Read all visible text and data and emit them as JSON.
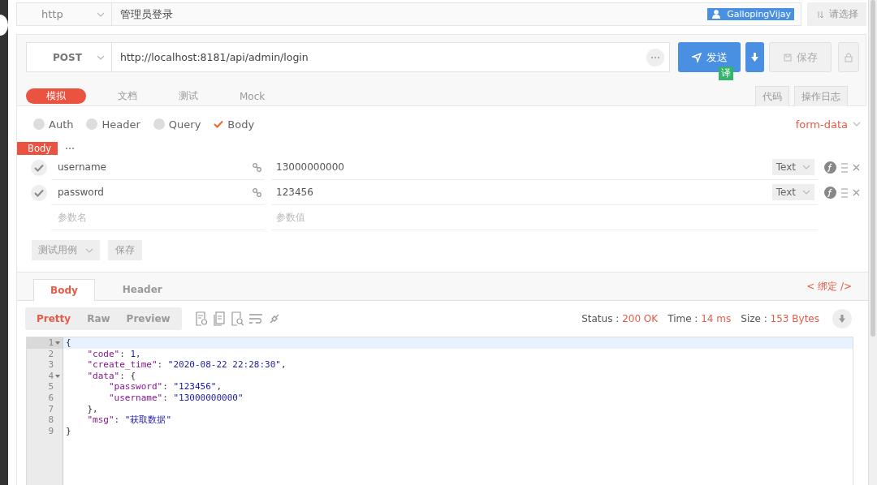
{
  "top_bar": {
    "protocol": "http",
    "name": "管理员登录",
    "user": "GallopingVijay",
    "sort_label": "请选择"
  },
  "request": {
    "method": "POST",
    "url": "http://localhost:8181/api/admin/login",
    "send": "发送",
    "translate_badge": "译",
    "save": "保存"
  },
  "mode_tabs": [
    {
      "label": "模拟",
      "selected": true
    },
    {
      "label": "文档",
      "selected": false
    },
    {
      "label": "测试",
      "selected": false
    },
    {
      "label": "Mock",
      "selected": false
    }
  ],
  "side_tabs": [
    "代码",
    "操作日志"
  ],
  "param_types": [
    {
      "label": "Auth",
      "checked": false
    },
    {
      "label": "Header",
      "checked": false
    },
    {
      "label": "Query",
      "checked": false
    },
    {
      "label": "Body",
      "checked": true
    }
  ],
  "body_format": "form-data",
  "body_tag": "Body",
  "params": [
    {
      "checked": true,
      "name": "username",
      "value": "13000000000",
      "type": "Text"
    },
    {
      "checked": true,
      "name": "password",
      "value": "123456",
      "type": "Text"
    }
  ],
  "new_param": {
    "name_placeholder": "参数名",
    "value_placeholder": "参数值"
  },
  "test_case": "测试用例",
  "save_params": "保存",
  "response": {
    "tabs": [
      {
        "label": "Body",
        "selected": true
      },
      {
        "label": "Header",
        "selected": false
      }
    ],
    "bind_link": "< 绑定 />",
    "views": [
      {
        "label": "Pretty",
        "selected": true
      },
      {
        "label": "Raw",
        "selected": false
      },
      {
        "label": "Preview",
        "selected": false
      }
    ],
    "status_label": "Status :",
    "status": "200 OK",
    "time_label": "Time :",
    "time": "14 ms",
    "size_label": "Size :",
    "size": "153 Bytes",
    "code_lines": [
      {
        "number": "1",
        "fold": true,
        "highlighted": true,
        "tokens": [
          {
            "kind": "punct",
            "text": "{"
          }
        ]
      },
      {
        "number": "2",
        "fold": false,
        "highlighted": false,
        "tokens": [
          {
            "kind": "key",
            "text": "    \"code\""
          },
          {
            "kind": "punct",
            "text": ": "
          },
          {
            "kind": "number",
            "text": "1"
          },
          {
            "kind": "punct",
            "text": ","
          }
        ]
      },
      {
        "number": "3",
        "fold": false,
        "highlighted": false,
        "tokens": [
          {
            "kind": "key",
            "text": "    \"create_time\""
          },
          {
            "kind": "punct",
            "text": ": "
          },
          {
            "kind": "string",
            "text": "\"2020-08-22 22:28:30\""
          },
          {
            "kind": "punct",
            "text": ","
          }
        ]
      },
      {
        "number": "4",
        "fold": true,
        "highlighted": false,
        "tokens": [
          {
            "kind": "key",
            "text": "    \"data\""
          },
          {
            "kind": "punct",
            "text": ": {"
          }
        ]
      },
      {
        "number": "5",
        "fold": false,
        "highlighted": false,
        "tokens": [
          {
            "kind": "key",
            "text": "        \"password\""
          },
          {
            "kind": "punct",
            "text": ": "
          },
          {
            "kind": "string",
            "text": "\"123456\""
          },
          {
            "kind": "punct",
            "text": ","
          }
        ]
      },
      {
        "number": "6",
        "fold": false,
        "highlighted": false,
        "tokens": [
          {
            "kind": "key",
            "text": "        \"username\""
          },
          {
            "kind": "punct",
            "text": ": "
          },
          {
            "kind": "string",
            "text": "\"13000000000\""
          }
        ]
      },
      {
        "number": "7",
        "fold": false,
        "highlighted": false,
        "tokens": [
          {
            "kind": "punct",
            "text": "    },"
          }
        ]
      },
      {
        "number": "8",
        "fold": false,
        "highlighted": false,
        "tokens": [
          {
            "kind": "key",
            "text": "    \"msg\""
          },
          {
            "kind": "punct",
            "text": ": "
          },
          {
            "kind": "string",
            "text": "\"获取数据\""
          }
        ]
      },
      {
        "number": "9",
        "fold": false,
        "highlighted": false,
        "tokens": [
          {
            "kind": "punct",
            "text": "}"
          }
        ]
      }
    ]
  }
}
